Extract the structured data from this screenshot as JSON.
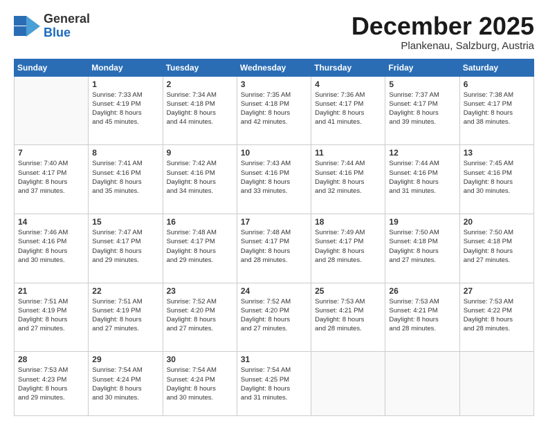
{
  "logo": {
    "general": "General",
    "blue": "Blue"
  },
  "header": {
    "month": "December 2025",
    "location": "Plankenau, Salzburg, Austria"
  },
  "weekdays": [
    "Sunday",
    "Monday",
    "Tuesday",
    "Wednesday",
    "Thursday",
    "Friday",
    "Saturday"
  ],
  "weeks": [
    [
      {
        "day": "",
        "info": ""
      },
      {
        "day": "1",
        "info": "Sunrise: 7:33 AM\nSunset: 4:19 PM\nDaylight: 8 hours\nand 45 minutes."
      },
      {
        "day": "2",
        "info": "Sunrise: 7:34 AM\nSunset: 4:18 PM\nDaylight: 8 hours\nand 44 minutes."
      },
      {
        "day": "3",
        "info": "Sunrise: 7:35 AM\nSunset: 4:18 PM\nDaylight: 8 hours\nand 42 minutes."
      },
      {
        "day": "4",
        "info": "Sunrise: 7:36 AM\nSunset: 4:17 PM\nDaylight: 8 hours\nand 41 minutes."
      },
      {
        "day": "5",
        "info": "Sunrise: 7:37 AM\nSunset: 4:17 PM\nDaylight: 8 hours\nand 39 minutes."
      },
      {
        "day": "6",
        "info": "Sunrise: 7:38 AM\nSunset: 4:17 PM\nDaylight: 8 hours\nand 38 minutes."
      }
    ],
    [
      {
        "day": "7",
        "info": "Sunrise: 7:40 AM\nSunset: 4:17 PM\nDaylight: 8 hours\nand 37 minutes."
      },
      {
        "day": "8",
        "info": "Sunrise: 7:41 AM\nSunset: 4:16 PM\nDaylight: 8 hours\nand 35 minutes."
      },
      {
        "day": "9",
        "info": "Sunrise: 7:42 AM\nSunset: 4:16 PM\nDaylight: 8 hours\nand 34 minutes."
      },
      {
        "day": "10",
        "info": "Sunrise: 7:43 AM\nSunset: 4:16 PM\nDaylight: 8 hours\nand 33 minutes."
      },
      {
        "day": "11",
        "info": "Sunrise: 7:44 AM\nSunset: 4:16 PM\nDaylight: 8 hours\nand 32 minutes."
      },
      {
        "day": "12",
        "info": "Sunrise: 7:44 AM\nSunset: 4:16 PM\nDaylight: 8 hours\nand 31 minutes."
      },
      {
        "day": "13",
        "info": "Sunrise: 7:45 AM\nSunset: 4:16 PM\nDaylight: 8 hours\nand 30 minutes."
      }
    ],
    [
      {
        "day": "14",
        "info": "Sunrise: 7:46 AM\nSunset: 4:16 PM\nDaylight: 8 hours\nand 30 minutes."
      },
      {
        "day": "15",
        "info": "Sunrise: 7:47 AM\nSunset: 4:17 PM\nDaylight: 8 hours\nand 29 minutes."
      },
      {
        "day": "16",
        "info": "Sunrise: 7:48 AM\nSunset: 4:17 PM\nDaylight: 8 hours\nand 29 minutes."
      },
      {
        "day": "17",
        "info": "Sunrise: 7:48 AM\nSunset: 4:17 PM\nDaylight: 8 hours\nand 28 minutes."
      },
      {
        "day": "18",
        "info": "Sunrise: 7:49 AM\nSunset: 4:17 PM\nDaylight: 8 hours\nand 28 minutes."
      },
      {
        "day": "19",
        "info": "Sunrise: 7:50 AM\nSunset: 4:18 PM\nDaylight: 8 hours\nand 27 minutes."
      },
      {
        "day": "20",
        "info": "Sunrise: 7:50 AM\nSunset: 4:18 PM\nDaylight: 8 hours\nand 27 minutes."
      }
    ],
    [
      {
        "day": "21",
        "info": "Sunrise: 7:51 AM\nSunset: 4:19 PM\nDaylight: 8 hours\nand 27 minutes."
      },
      {
        "day": "22",
        "info": "Sunrise: 7:51 AM\nSunset: 4:19 PM\nDaylight: 8 hours\nand 27 minutes."
      },
      {
        "day": "23",
        "info": "Sunrise: 7:52 AM\nSunset: 4:20 PM\nDaylight: 8 hours\nand 27 minutes."
      },
      {
        "day": "24",
        "info": "Sunrise: 7:52 AM\nSunset: 4:20 PM\nDaylight: 8 hours\nand 27 minutes."
      },
      {
        "day": "25",
        "info": "Sunrise: 7:53 AM\nSunset: 4:21 PM\nDaylight: 8 hours\nand 28 minutes."
      },
      {
        "day": "26",
        "info": "Sunrise: 7:53 AM\nSunset: 4:21 PM\nDaylight: 8 hours\nand 28 minutes."
      },
      {
        "day": "27",
        "info": "Sunrise: 7:53 AM\nSunset: 4:22 PM\nDaylight: 8 hours\nand 28 minutes."
      }
    ],
    [
      {
        "day": "28",
        "info": "Sunrise: 7:53 AM\nSunset: 4:23 PM\nDaylight: 8 hours\nand 29 minutes."
      },
      {
        "day": "29",
        "info": "Sunrise: 7:54 AM\nSunset: 4:24 PM\nDaylight: 8 hours\nand 30 minutes."
      },
      {
        "day": "30",
        "info": "Sunrise: 7:54 AM\nSunset: 4:24 PM\nDaylight: 8 hours\nand 30 minutes."
      },
      {
        "day": "31",
        "info": "Sunrise: 7:54 AM\nSunset: 4:25 PM\nDaylight: 8 hours\nand 31 minutes."
      },
      {
        "day": "",
        "info": ""
      },
      {
        "day": "",
        "info": ""
      },
      {
        "day": "",
        "info": ""
      }
    ]
  ]
}
